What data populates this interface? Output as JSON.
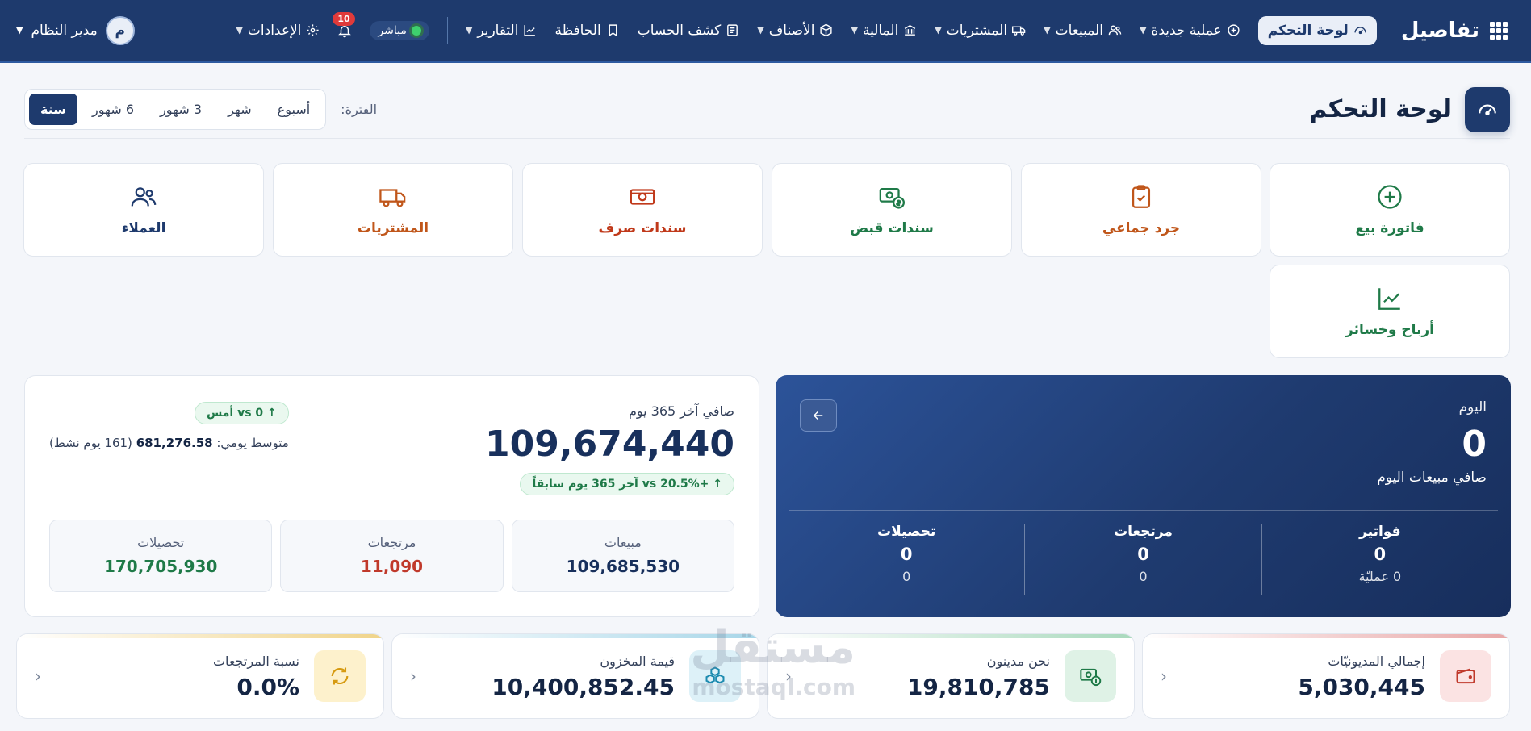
{
  "brand": {
    "name": "تفاصيل"
  },
  "nav": {
    "items": [
      {
        "label": "لوحة التحكم",
        "icon": "gauge-icon",
        "active": true,
        "caret": false
      },
      {
        "label": "عملية جديدة",
        "icon": "plus-circle-icon",
        "caret": true
      },
      {
        "label": "المبيعات",
        "icon": "users-icon",
        "caret": true
      },
      {
        "label": "المشتريات",
        "icon": "truck-icon",
        "caret": true
      },
      {
        "label": "المالية",
        "icon": "bank-icon",
        "caret": true
      },
      {
        "label": "الأصناف",
        "icon": "box-icon",
        "caret": true
      },
      {
        "label": "كشف الحساب",
        "icon": "ledger-icon",
        "caret": false
      },
      {
        "label": "الحافظة",
        "icon": "bookmark-icon",
        "caret": false
      },
      {
        "label": "التقارير",
        "icon": "chart-line-icon",
        "caret": true
      }
    ],
    "live_label": "مباشر",
    "notifications_count": "10",
    "settings_label": "الإعدادات",
    "user_name": "مدير النظام",
    "user_initial": "م"
  },
  "header": {
    "title": "لوحة التحكم",
    "period_label": "الفترة:"
  },
  "period_tabs": [
    {
      "label": "أسبوع",
      "active": false
    },
    {
      "label": "شهر",
      "active": false
    },
    {
      "label": "3 شهور",
      "active": false
    },
    {
      "label": "6 شهور",
      "active": false
    },
    {
      "label": "سنة",
      "active": true
    }
  ],
  "quick_actions": [
    {
      "label": "فاتورة بيع",
      "icon": "plus-circle-icon",
      "color": "#1f7a48"
    },
    {
      "label": "جرد جماعي",
      "icon": "clipboard-check-icon",
      "color": "#c0561a"
    },
    {
      "label": "سندات قبض",
      "icon": "cash-receipt-icon",
      "color": "#1f7a48"
    },
    {
      "label": "سندات صرف",
      "icon": "cash-payment-icon",
      "color": "#c0391a"
    },
    {
      "label": "المشتريات",
      "icon": "truck-icon",
      "color": "#c0561a"
    },
    {
      "label": "العملاء",
      "icon": "users-icon",
      "color": "#1e3a6d"
    },
    {
      "label": "أرباح وخسائر",
      "icon": "chart-line-icon",
      "color": "#1f7a48"
    }
  ],
  "today": {
    "title": "اليوم",
    "value": "0",
    "subtitle": "صافي مبيعات اليوم",
    "stats": [
      {
        "label": "فواتير",
        "value": "0",
        "sub": "0 عمليّة"
      },
      {
        "label": "مرتجعات",
        "value": "0",
        "sub": "0"
      },
      {
        "label": "تحصيلات",
        "value": "0",
        "sub": "0"
      }
    ]
  },
  "summary": {
    "label": "صافي آخر 365 يوم",
    "value": "109,674,440",
    "growth": "+20.5% vs آخر 365 يوم سابقاً",
    "vs_yesterday": "0 vs أمس",
    "avg_label": "متوسط يومي:",
    "avg_value": "681,276.58",
    "avg_note": "(161 يوم نشط)",
    "mini": [
      {
        "label": "مبيعات",
        "value": "109,685,530",
        "color": "#18305c"
      },
      {
        "label": "مرتجعات",
        "value": "11,090",
        "color": "#c0392b"
      },
      {
        "label": "تحصيلات",
        "value": "170,705,930",
        "color": "#1f7a48"
      }
    ]
  },
  "kpis": [
    {
      "label": "إجمالي المديونيّات",
      "value": "5,030,445",
      "icon": "wallet-icon",
      "accent": "#e8a7a7",
      "icon_bg": "#fbe3e3",
      "icon_color": "#c0392b"
    },
    {
      "label": "نحن مدينون",
      "value": "19,810,785",
      "icon": "cash-receipt-icon",
      "accent": "#a9d9bd",
      "icon_bg": "#dff2e6",
      "icon_color": "#1f7a48"
    },
    {
      "label": "قيمة المخزون",
      "value": "10,400,852.45",
      "icon": "cubes-icon",
      "accent": "#a7d6e8",
      "icon_bg": "#ddf1f8",
      "icon_color": "#1c8bb0"
    },
    {
      "label": "نسبة المرتجعات",
      "value": "0.0%",
      "icon": "refresh-icon",
      "accent": "#f0d48a",
      "icon_bg": "#fdf1cc",
      "icon_color": "#d69a10"
    }
  ],
  "watermark": {
    "line1": "مستقل",
    "line2": "mostaql.com"
  }
}
